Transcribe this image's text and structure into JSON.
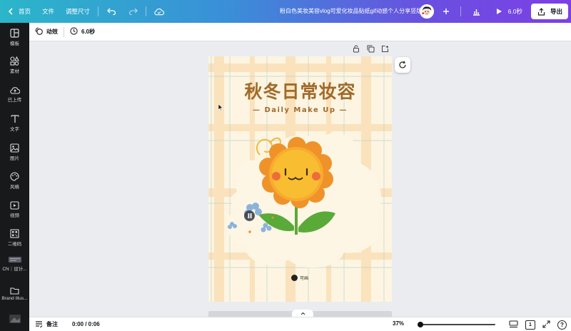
{
  "topbar": {
    "home_label": "首页",
    "file_label": "文件",
    "resize_label": "调整尺寸",
    "doc_title": "粉白色美妆美容vlog可爱化妆品贴纸gif动感个人分享竖版Vlog",
    "play_label": "6.0秒",
    "export_label": "导出"
  },
  "sidebar": {
    "items": [
      {
        "label": "模板",
        "icon": "template-icon"
      },
      {
        "label": "素材",
        "icon": "elements-icon"
      },
      {
        "label": "已上传",
        "icon": "upload-icon"
      },
      {
        "label": "文字",
        "icon": "text-icon"
      },
      {
        "label": "图片",
        "icon": "photo-icon"
      },
      {
        "label": "风格",
        "icon": "palette-icon"
      },
      {
        "label": "视频",
        "icon": "video-icon"
      },
      {
        "label": "二维码",
        "icon": "qrcode-icon"
      },
      {
        "label": "CN｜设计...",
        "icon": "brand-folder-icon"
      },
      {
        "label": "Brand Illus...",
        "icon": "folder-icon"
      }
    ]
  },
  "context_bar": {
    "animate_label": "动效",
    "duration_label": "6.0秒"
  },
  "design": {
    "title": "秋冬日常妆容",
    "subtitle": "— Daily Make Up —",
    "brand": "可画"
  },
  "bottombar": {
    "notes_label": "备注",
    "time": "0:00 / 0:06",
    "zoom": "37%",
    "zoom_fraction": 0.37,
    "page_count": "1",
    "help": "?"
  },
  "colors": {
    "accent_gradient_start": "#2bb6c9",
    "accent_gradient_end": "#7d3fe6",
    "title_brown": "#a06a2a",
    "sunflower_orange": "#f0922a",
    "sunflower_yellow": "#f7b32b",
    "leaf_green": "#5aaa3a"
  }
}
